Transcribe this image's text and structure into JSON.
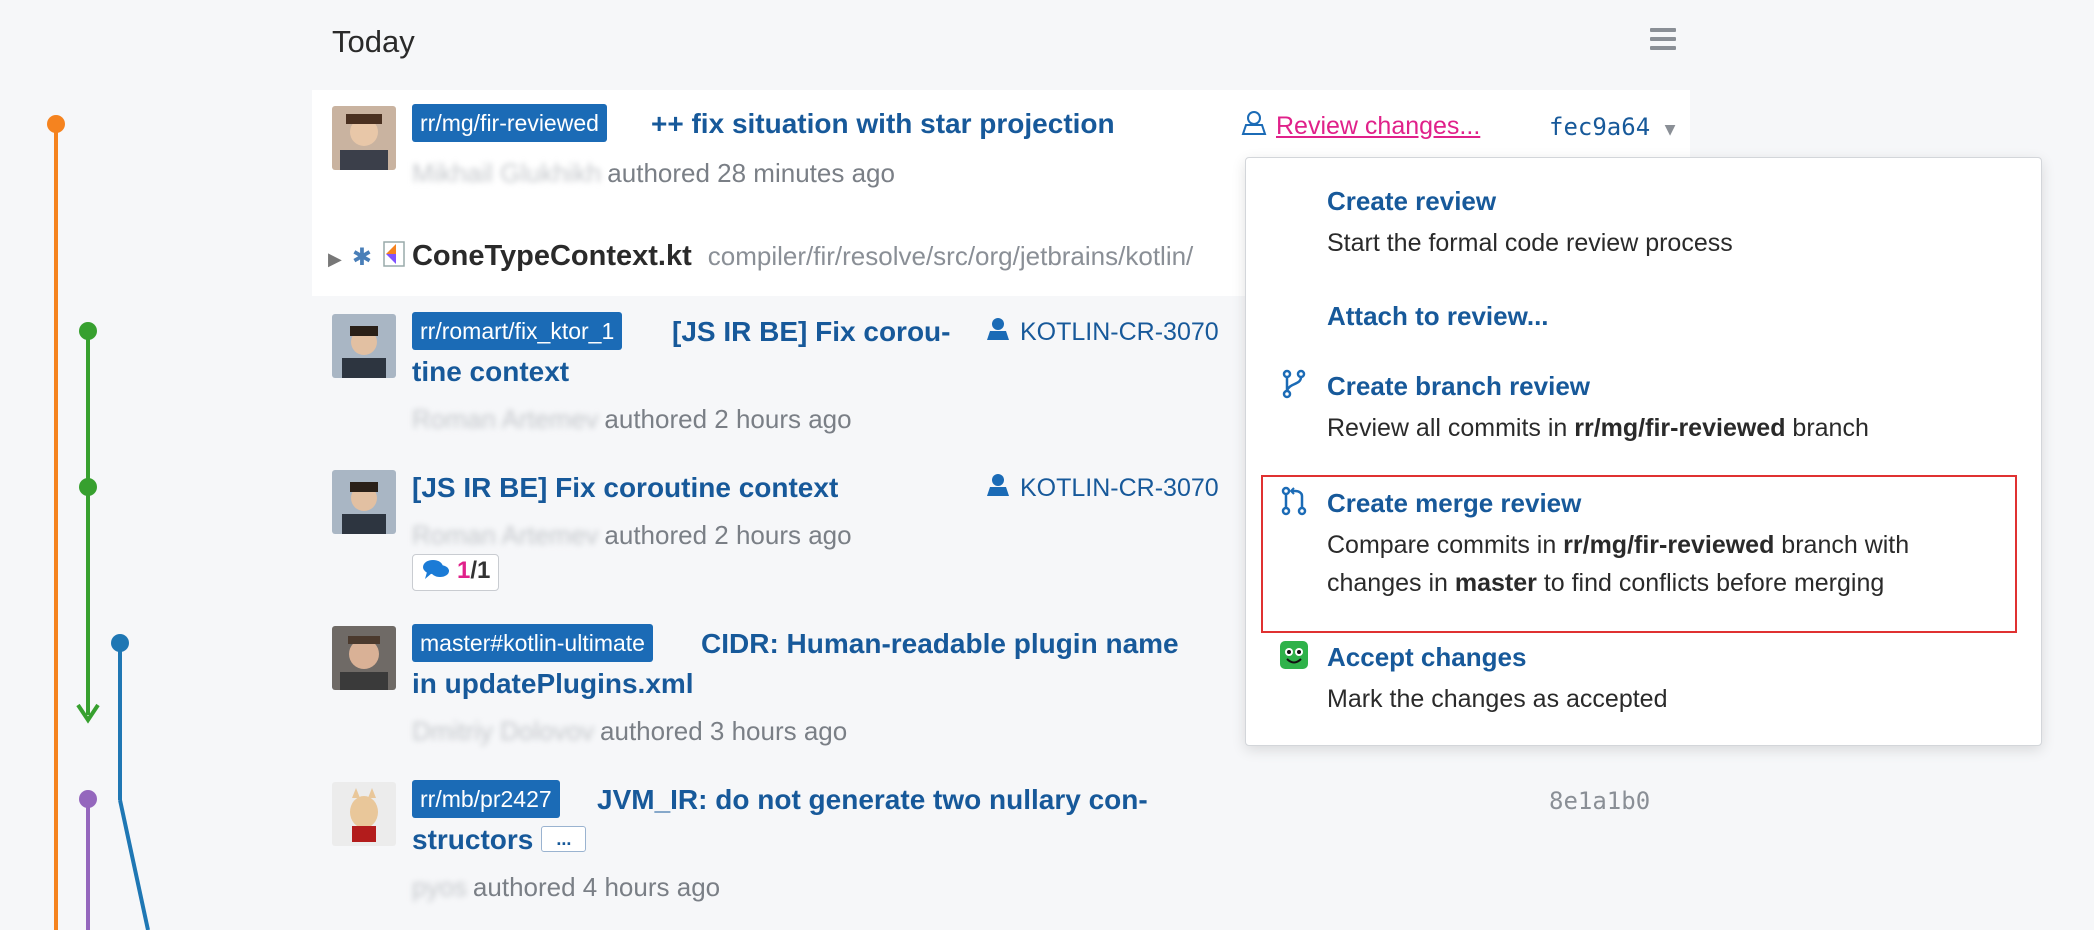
{
  "heading": {
    "title": "Today"
  },
  "colors": {
    "accent": "#1b6bb6",
    "link_pink": "#e0218a",
    "graph_orange": "#f5831f",
    "graph_green": "#37a02f",
    "graph_blue": "#1f77b4",
    "graph_purple": "#9467bd",
    "highlight": "#e03131"
  },
  "commits": [
    {
      "branch": "rr/mg/fir-reviewed",
      "message": "++ fix situation with star projection",
      "author": "Mikhail Glukhikh",
      "time": "authored 28 minutes ago",
      "review_link": "Review changes...",
      "hash": "fec9a64",
      "file": {
        "name": "ConeTypeContext.kt",
        "path": "compiler/fir/resolve/src/org/jetbrains/kotlin/"
      }
    },
    {
      "branch": "rr/romart/fix_ktor_1",
      "message_line1": "[JS IR BE] Fix corou-",
      "message_line2": "tine context",
      "ticket": "KOTLIN-CR-3070",
      "author": "Roman Artemev",
      "time": "authored 2 hours ago"
    },
    {
      "message": "[JS IR BE] Fix coroutine context",
      "ticket": "KOTLIN-CR-3070",
      "author": "Roman Artemev",
      "time": "authored 2 hours ago",
      "comments_new": "1",
      "comments_total": "/1"
    },
    {
      "branch": "master#kotlin-ultimate",
      "message_line1": "CIDR: Human-readable plugin name",
      "message_line2": "in updatePlugins.xml",
      "author": "Dmitriy Dolovov",
      "time": "authored 3 hours ago"
    },
    {
      "branch": "rr/mb/pr2427",
      "message_line1": "JVM_IR: do not generate two nullary con-",
      "message_line2": "structors",
      "more": "...",
      "author": "pyos",
      "time": "authored 4 hours ago",
      "hash": "8e1a1b0"
    }
  ],
  "menu": {
    "items": [
      {
        "title": "Create review",
        "desc": "Start the formal code review process",
        "icon": "none"
      },
      {
        "title": "Attach to review...",
        "icon": "none"
      },
      {
        "title": "Create branch review",
        "desc_pre": "Review all commits in ",
        "desc_bold": "rr/mg/fir-reviewed",
        "desc_post": " branch",
        "icon": "branch-icon"
      },
      {
        "title": "Create merge review",
        "desc_pre": "Compare commits in ",
        "desc_bold": "rr/mg/fir-reviewed",
        "desc_mid": " branch with changes in ",
        "desc_bold2": "master",
        "desc_post": " to find conflicts before merging",
        "icon": "merge-icon"
      },
      {
        "title": "Accept changes",
        "desc": "Mark the changes as accepted",
        "icon": "accept-face-icon"
      }
    ]
  }
}
